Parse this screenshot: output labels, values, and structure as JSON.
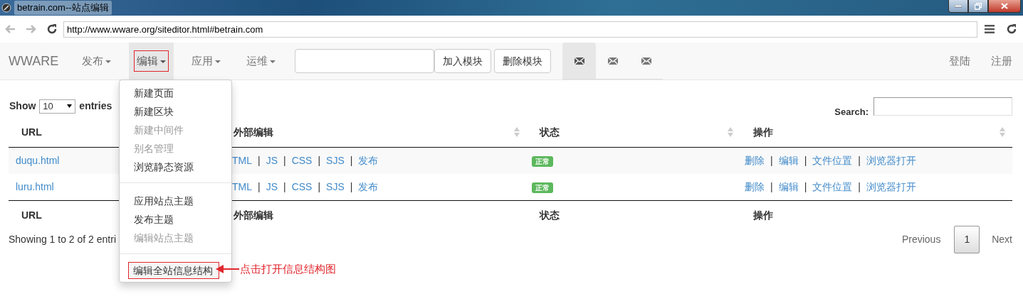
{
  "window": {
    "title": "betrain.com--站点编辑"
  },
  "browser": {
    "url": "http://www.wware.org/siteditor.html#betrain.com"
  },
  "navbar": {
    "brand": "WWARE",
    "menus": [
      {
        "label": "发布",
        "selected": false,
        "annotated": false
      },
      {
        "label": "编辑",
        "selected": true,
        "annotated": true
      },
      {
        "label": "应用",
        "selected": false,
        "annotated": false
      },
      {
        "label": "运维",
        "selected": false,
        "annotated": false
      }
    ],
    "buttons": [
      "加入模块",
      "删除模块"
    ],
    "icon_tabs": [
      {
        "selected": true
      },
      {
        "selected": false
      },
      {
        "selected": false
      }
    ],
    "right_links": [
      "登陆",
      "注册"
    ]
  },
  "dropdown": {
    "groups": [
      [
        {
          "label": "新建页面",
          "disabled": false,
          "annotated": false
        },
        {
          "label": "新建区块",
          "disabled": false,
          "annotated": false
        },
        {
          "label": "新建中间件",
          "disabled": true,
          "annotated": false
        },
        {
          "label": "别名管理",
          "disabled": true,
          "annotated": false
        },
        {
          "label": "浏览静态资源",
          "disabled": false,
          "annotated": false
        }
      ],
      [
        {
          "label": "应用站点主题",
          "disabled": false,
          "annotated": false
        },
        {
          "label": "发布主题",
          "disabled": false,
          "annotated": false
        },
        {
          "label": "编辑站点主题",
          "disabled": true,
          "annotated": false
        }
      ],
      [
        {
          "label": "编辑全站信息结构",
          "disabled": false,
          "annotated": true
        }
      ]
    ]
  },
  "annotation": {
    "text": "点击打开信息结构图"
  },
  "table_controls": {
    "show_label": "Show",
    "page_length": "10",
    "entries_label": "entries",
    "search_label": "Search:"
  },
  "table": {
    "columns": [
      {
        "label": "URL",
        "sort_icon": false
      },
      {
        "label": "外部编辑",
        "sort_icon": true
      },
      {
        "label": "状态",
        "sort_icon": true
      },
      {
        "label": "操作",
        "sort_icon": true
      }
    ],
    "rows": [
      {
        "url": "duqu.html",
        "external_links": [
          {
            "kind": "link",
            "text": "TML"
          },
          {
            "kind": "separator",
            "text": "|"
          },
          {
            "kind": "link",
            "text": "JS"
          },
          {
            "kind": "separator",
            "text": "|"
          },
          {
            "kind": "link",
            "text": "CSS"
          },
          {
            "kind": "separator",
            "text": "|"
          },
          {
            "kind": "link",
            "text": "SJS"
          },
          {
            "kind": "separator",
            "text": "|"
          },
          {
            "kind": "link",
            "text": "发布"
          }
        ],
        "status": "正常",
        "actions": [
          {
            "kind": "link",
            "text": "删除"
          },
          {
            "kind": "separator",
            "text": "|"
          },
          {
            "kind": "link",
            "text": "编辑"
          },
          {
            "kind": "separator",
            "text": "|"
          },
          {
            "kind": "link",
            "text": "文件位置"
          },
          {
            "kind": "separator",
            "text": "|"
          },
          {
            "kind": "link",
            "text": "浏览器打开"
          }
        ]
      },
      {
        "url": "luru.html",
        "external_links": [
          {
            "kind": "link",
            "text": "TML"
          },
          {
            "kind": "separator",
            "text": "|"
          },
          {
            "kind": "link",
            "text": "JS"
          },
          {
            "kind": "separator",
            "text": "|"
          },
          {
            "kind": "link",
            "text": "CSS"
          },
          {
            "kind": "separator",
            "text": "|"
          },
          {
            "kind": "link",
            "text": "SJS"
          },
          {
            "kind": "separator",
            "text": "|"
          },
          {
            "kind": "link",
            "text": "发布"
          }
        ],
        "status": "正常",
        "actions": [
          {
            "kind": "link",
            "text": "删除"
          },
          {
            "kind": "separator",
            "text": "|"
          },
          {
            "kind": "link",
            "text": "编辑"
          },
          {
            "kind": "separator",
            "text": "|"
          },
          {
            "kind": "link",
            "text": "文件位置"
          },
          {
            "kind": "separator",
            "text": "|"
          },
          {
            "kind": "link",
            "text": "浏览器打开"
          }
        ]
      }
    ],
    "footer": [
      "URL",
      "外部编辑",
      "状态",
      "操作"
    ]
  },
  "info": "Showing 1 to 2 of 2 entri",
  "pagination": {
    "previous": "Previous",
    "pages": [
      {
        "label": "1",
        "selected": true
      }
    ],
    "next": "Next"
  }
}
